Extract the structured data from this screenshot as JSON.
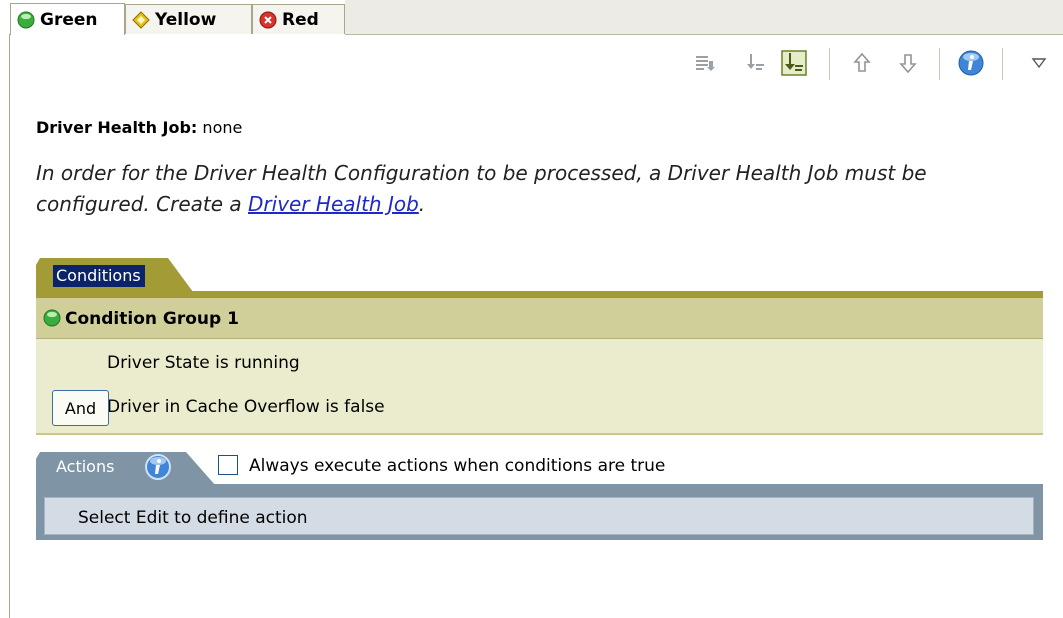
{
  "tabs": [
    {
      "label": "Green",
      "icon": "green-circle-icon",
      "color": "#3dab3d",
      "active": true
    },
    {
      "label": "Yellow",
      "icon": "yellow-diamond-icon",
      "color": "#e7c11a",
      "active": false
    },
    {
      "label": "Red",
      "icon": "red-x-circle-icon",
      "color": "#d9332b",
      "active": false
    }
  ],
  "toolbar": {
    "icons": [
      "list-down-icon",
      "sort-icon",
      "expand-collapse-icon",
      "move-up-icon",
      "move-down-icon",
      "info-icon",
      "view-menu-icon"
    ]
  },
  "driver_health": {
    "label": "Driver Health Job:",
    "value": "none"
  },
  "message": {
    "text_before": "In order for the Driver Health Configuration to be processed, a Driver Health Job must be configured. Create a ",
    "link_text": "Driver Health Job",
    "text_after": "."
  },
  "conditions": {
    "tab_label": "Conditions",
    "group_title": "Condition Group 1",
    "rows": [
      "Driver State is running",
      "Driver in Cache Overflow is false"
    ],
    "and_button": "And",
    "accent_color": "#a29b36"
  },
  "actions": {
    "tab_label": "Actions",
    "checkbox_label": "Always execute actions when conditions are true",
    "checkbox_checked": false,
    "placeholder": "Select Edit to define action",
    "accent_color": "#7f95a6"
  }
}
